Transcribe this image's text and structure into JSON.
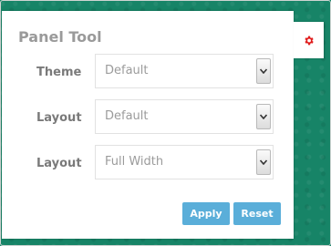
{
  "panel": {
    "title": "Panel Tool",
    "rows": [
      {
        "label": "Theme",
        "value": "Default"
      },
      {
        "label": "Layout",
        "value": "Default"
      },
      {
        "label": "Layout",
        "value": "Full Width"
      }
    ],
    "apply_label": "Apply",
    "reset_label": "Reset"
  },
  "tab": {
    "icon": "gear-icon"
  },
  "colors": {
    "background": "#178467",
    "accent_button": "#5aaed9",
    "gear": "#e01b1b",
    "label": "#7a7a7a"
  }
}
